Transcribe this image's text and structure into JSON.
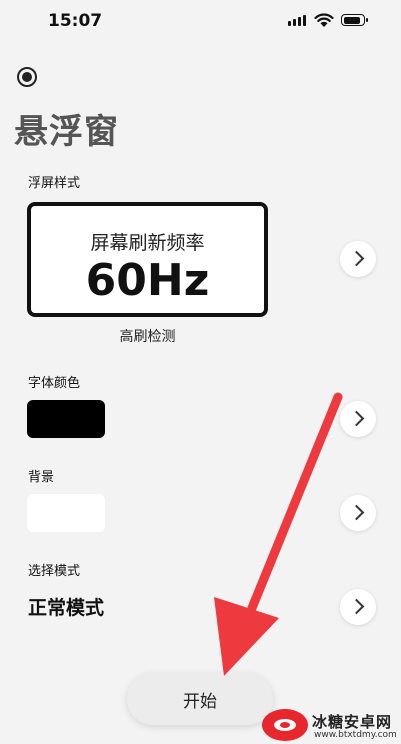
{
  "status_bar": {
    "time": "15:07"
  },
  "page": {
    "title": "悬浮窗"
  },
  "float_style": {
    "label": "浮屏样式",
    "preview_title": "屏幕刷新频率",
    "preview_value": "60Hz",
    "caption": "高刷检测"
  },
  "font_color": {
    "label": "字体颜色",
    "color": "#000000"
  },
  "background": {
    "label": "背景",
    "color": "#ffffff"
  },
  "mode": {
    "label": "选择模式",
    "value": "正常模式"
  },
  "start_button": {
    "label": "开始"
  },
  "watermark": {
    "title": "冰糖安卓网",
    "url": "www.btxtdmy.com"
  },
  "colors": {
    "accent_arrow": "#ee3a3f",
    "background": "#f3f3f3"
  }
}
